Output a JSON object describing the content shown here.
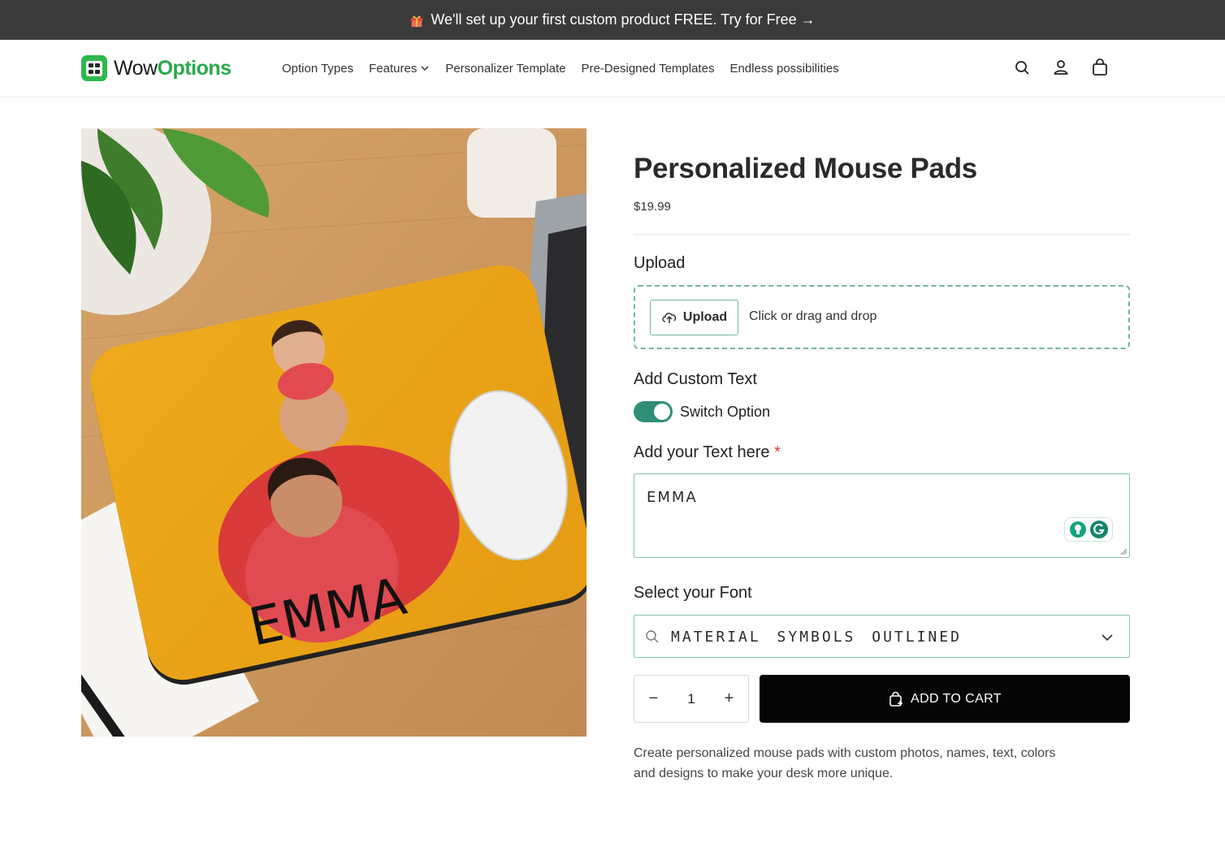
{
  "announcement": {
    "text": "We'll set up your first custom product FREE. Try for Free →",
    "icon": "gift-icon"
  },
  "brand": {
    "name_part1": "Wow",
    "name_part2": "Options",
    "color": "#2aa84a"
  },
  "nav": {
    "items": [
      {
        "label": "Option Types"
      },
      {
        "label": "Features",
        "has_dropdown": true
      },
      {
        "label": "Personalizer Template"
      },
      {
        "label": "Pre-Designed Templates"
      },
      {
        "label": "Endless possibilities"
      }
    ],
    "icons": [
      "search-icon",
      "account-icon",
      "cart-icon"
    ]
  },
  "product": {
    "title": "Personalized Mouse Pads",
    "price": "$19.99",
    "image_text": "EMMA",
    "description": "Create personalized mouse pads with custom photos, names, text, colors and designs to make your desk more unique."
  },
  "options": {
    "upload": {
      "label": "Upload",
      "button_label": "Upload",
      "hint": "Click or drag and drop"
    },
    "custom_text": {
      "label": "Add Custom Text",
      "switch_label": "Switch Option",
      "switch_on": true
    },
    "text_input": {
      "label": "Add your Text here",
      "required_mark": "*",
      "value": "EMMA"
    },
    "font": {
      "label": "Select your Font",
      "value": "MATERIAL SYMBOLS OUTLINED"
    }
  },
  "cart": {
    "quantity": "1",
    "minus": "−",
    "plus": "+",
    "add_label": "ADD TO CART"
  },
  "colors": {
    "accent": "#2e8f76",
    "border": "#86c2b2",
    "cart_bg": "#050505",
    "announce_bg": "#3a3a3a"
  }
}
